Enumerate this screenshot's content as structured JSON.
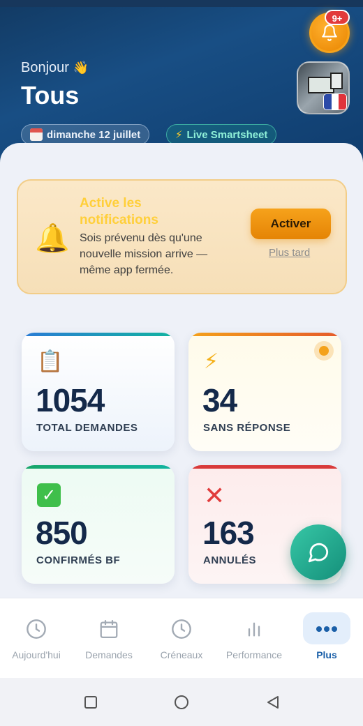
{
  "header": {
    "greeting": "Bonjour",
    "greeting_emoji": "👋",
    "title": "Tous",
    "notification_badge": "9+",
    "date_chip": "dimanche 12 juillet",
    "live_chip": "Live Smartsheet"
  },
  "notification_card": {
    "title": "Active les notifications",
    "text": "Sois prévenu dès qu'une nouvelle mission arrive — même app fermée.",
    "activate_label": "Activer",
    "later_label": "Plus tard"
  },
  "stats": [
    {
      "value": "1054",
      "label": "TOTAL DEMANDES",
      "icon": "clipboard-icon",
      "color": "#2a7bd6"
    },
    {
      "value": "34",
      "label": "SANS RÉPONSE",
      "icon": "lightning-icon",
      "color": "#f4a11a"
    },
    {
      "value": "850",
      "label": "CONFIRMÉS BF",
      "icon": "check-icon",
      "color": "#16a468"
    },
    {
      "value": "163",
      "label": "ANNULÉS",
      "icon": "cross-icon",
      "color": "#d83a3a"
    }
  ],
  "nav": {
    "items": [
      {
        "label": "Aujourd'hui",
        "icon": "clock-icon"
      },
      {
        "label": "Demandes",
        "icon": "calendar-icon"
      },
      {
        "label": "Créneaux",
        "icon": "clock-icon"
      },
      {
        "label": "Performance",
        "icon": "bar-chart-icon"
      },
      {
        "label": "Plus",
        "icon": "more-icon",
        "active": true
      }
    ]
  },
  "colors": {
    "header_bg": "#184e84",
    "accent_orange": "#f4a11a",
    "accent_teal": "#148f7a",
    "active_nav": "#1a5fa8"
  }
}
